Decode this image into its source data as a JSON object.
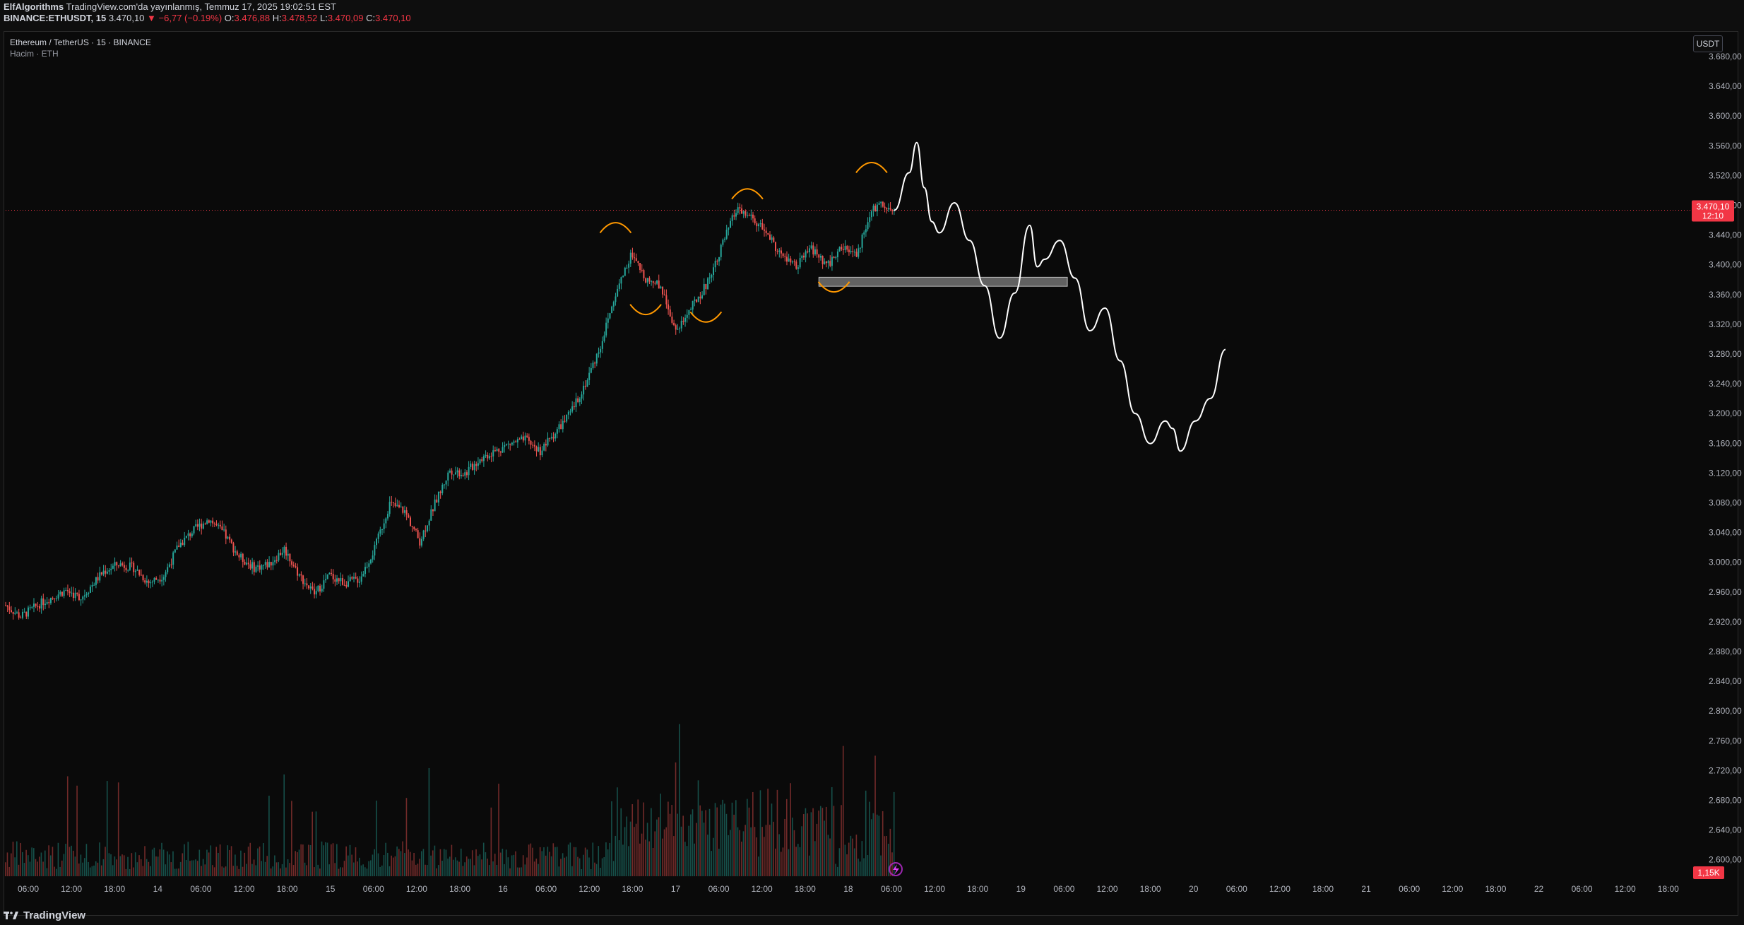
{
  "header": {
    "author": "ElfAlgorithms",
    "published": "TradingView.com'da yayınlanmış, Temmuz 17, 2025 19:02:51 EST",
    "symbol": "BINANCE:ETHUSDT, 15",
    "last": "3.470,10",
    "change": "▼ −6,77 (−0.19%)",
    "o_label": "O:",
    "o": "3.476,88",
    "h_label": "H:",
    "h": "3.478,52",
    "l_label": "L:",
    "l": "3.470,09",
    "c_label": "C:",
    "c": "3.470,10"
  },
  "legend": {
    "title": "Ethereum / TetherUS · 15 · BINANCE",
    "volume": "Hacim · ETH"
  },
  "currency": "USDT",
  "price_tag": {
    "price": "3.470,10",
    "countdown": "12:10"
  },
  "volume_tag": "1,15K",
  "footer": {
    "brand": "TradingView"
  },
  "colors": {
    "up": "#26a69a",
    "down": "#ef5350",
    "drawing": "#ffffff",
    "arc": "#ff9800",
    "zone": "#808080",
    "price_tag": "#f23645"
  },
  "chart_data": {
    "type": "candlestick",
    "interval": "15",
    "y_axis": {
      "ylim": [
        2600,
        3700
      ],
      "ticks": [
        "3.680,00",
        "3.640,00",
        "3.600,00",
        "3.560,00",
        "3.520,00",
        "3.480,00",
        "3.440,00",
        "3.400,00",
        "3.360,00",
        "3.320,00",
        "3.280,00",
        "3.240,00",
        "3.200,00",
        "3.160,00",
        "3.120,00",
        "3.080,00",
        "3.040,00",
        "3.000,00",
        "2.960,00",
        "2.920,00",
        "2.880,00",
        "2.840,00",
        "2.800,00",
        "2.760,00",
        "2.720,00",
        "2.680,00",
        "2.640,00",
        "2.600,00"
      ]
    },
    "x_axis": {
      "ticks": [
        "06:00",
        "12:00",
        "18:00",
        "14",
        "06:00",
        "12:00",
        "18:00",
        "15",
        "06:00",
        "12:00",
        "18:00",
        "16",
        "06:00",
        "12:00",
        "18:00",
        "17",
        "06:00",
        "12:00",
        "18:00",
        "18",
        "06:00",
        "12:00",
        "18:00",
        "19",
        "06:00",
        "12:00",
        "18:00",
        "20",
        "06:00",
        "12:00",
        "18:00",
        "21",
        "06:00",
        "12:00",
        "18:00",
        "22",
        "06:00",
        "12:00",
        "18:00"
      ]
    },
    "price_path": [
      [
        0,
        2945
      ],
      [
        4,
        2930
      ],
      [
        10,
        2950
      ],
      [
        16,
        2965
      ],
      [
        20,
        2955
      ],
      [
        26,
        2990
      ],
      [
        30,
        3000
      ],
      [
        34,
        2995
      ],
      [
        38,
        2975
      ],
      [
        42,
        2985
      ],
      [
        46,
        3025
      ],
      [
        50,
        3045
      ],
      [
        54,
        3060
      ],
      [
        58,
        3040
      ],
      [
        62,
        3010
      ],
      [
        66,
        2995
      ],
      [
        70,
        3000
      ],
      [
        74,
        3020
      ],
      [
        78,
        2985
      ],
      [
        82,
        2960
      ],
      [
        86,
        2985
      ],
      [
        90,
        2975
      ],
      [
        94,
        2980
      ],
      [
        98,
        3020
      ],
      [
        102,
        3080
      ],
      [
        106,
        3070
      ],
      [
        110,
        3030
      ],
      [
        114,
        3080
      ],
      [
        118,
        3125
      ],
      [
        122,
        3120
      ],
      [
        126,
        3140
      ],
      [
        130,
        3150
      ],
      [
        134,
        3160
      ],
      [
        138,
        3165
      ],
      [
        142,
        3150
      ],
      [
        146,
        3175
      ],
      [
        150,
        3200
      ],
      [
        154,
        3240
      ],
      [
        158,
        3290
      ],
      [
        162,
        3360
      ],
      [
        166,
        3410
      ],
      [
        170,
        3380
      ],
      [
        174,
        3370
      ],
      [
        178,
        3310
      ],
      [
        182,
        3340
      ],
      [
        186,
        3370
      ],
      [
        190,
        3420
      ],
      [
        194,
        3470
      ],
      [
        198,
        3460
      ],
      [
        202,
        3440
      ],
      [
        206,
        3410
      ],
      [
        210,
        3395
      ],
      [
        214,
        3420
      ],
      [
        218,
        3395
      ],
      [
        222,
        3420
      ],
      [
        226,
        3410
      ],
      [
        230,
        3470
      ],
      [
        233,
        3480
      ],
      [
        236,
        3470
      ]
    ],
    "projection": [
      [
        236,
        3470
      ],
      [
        240,
        3520
      ],
      [
        242,
        3560
      ],
      [
        244,
        3500
      ],
      [
        246,
        3455
      ],
      [
        248,
        3440
      ],
      [
        252,
        3480
      ],
      [
        256,
        3430
      ],
      [
        260,
        3370
      ],
      [
        264,
        3300
      ],
      [
        268,
        3360
      ],
      [
        272,
        3450
      ],
      [
        274,
        3395
      ],
      [
        276,
        3405
      ],
      [
        280,
        3430
      ],
      [
        284,
        3380
      ],
      [
        288,
        3310
      ],
      [
        292,
        3340
      ],
      [
        296,
        3270
      ],
      [
        300,
        3200
      ],
      [
        304,
        3160
      ],
      [
        308,
        3190
      ],
      [
        310,
        3180
      ],
      [
        312,
        3150
      ],
      [
        316,
        3190
      ],
      [
        320,
        3220
      ],
      [
        324,
        3285
      ]
    ],
    "zone": {
      "x_start": 216,
      "x_end": 282,
      "y_low": 3369,
      "y_high": 3381
    },
    "last_price": 3470.1,
    "volume": {
      "ylim": [
        0,
        5000
      ],
      "last": "1,15K"
    }
  }
}
